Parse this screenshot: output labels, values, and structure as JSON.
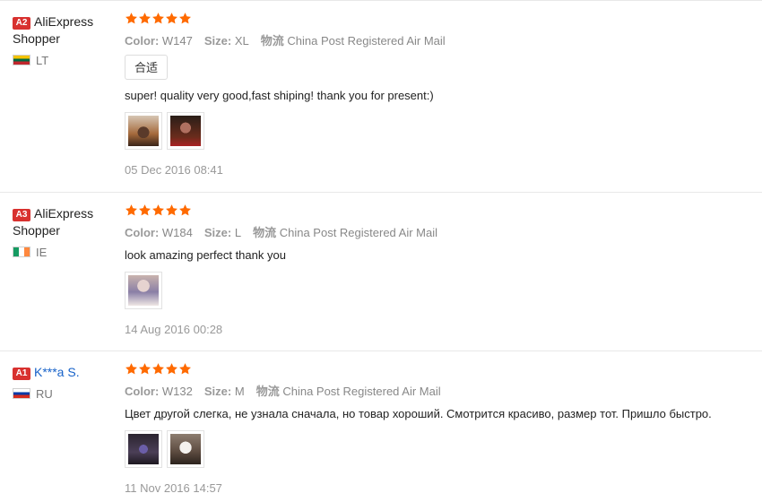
{
  "colors": {
    "star": "#ff6a00",
    "level_badge": "#d8312f",
    "link": "#1762c9"
  },
  "labels": {
    "color": "Color:",
    "size": "Size:",
    "shipping_cn": "物流"
  },
  "reviews": [
    {
      "level": "A2",
      "user": "AliExpress Shopper",
      "country": "LT",
      "rating": 5,
      "color": "W147",
      "size": "XL",
      "shipping": "China Post Registered Air Mail",
      "tag": "合适",
      "text": "super! quality very good,fast shiping! thank you for present:)",
      "photos": 2,
      "date": "05 Dec 2016 08:41"
    },
    {
      "level": "A3",
      "user": "AliExpress Shopper",
      "country": "IE",
      "rating": 5,
      "color": "W184",
      "size": "L",
      "shipping": "China Post Registered Air Mail",
      "text": "look amazing perfect thank you",
      "photos": 1,
      "date": "14 Aug 2016 00:28"
    },
    {
      "level": "A1",
      "user": "K***a S.",
      "country": "RU",
      "rating": 5,
      "color": "W132",
      "size": "M",
      "shipping": "China Post Registered Air Mail",
      "text": "Цвет другой слегка, не узнала сначала, но товар хороший. Смотрится красиво, размер тот. Пришло быстро.",
      "photos": 2,
      "date": "11 Nov 2016 14:57"
    }
  ]
}
